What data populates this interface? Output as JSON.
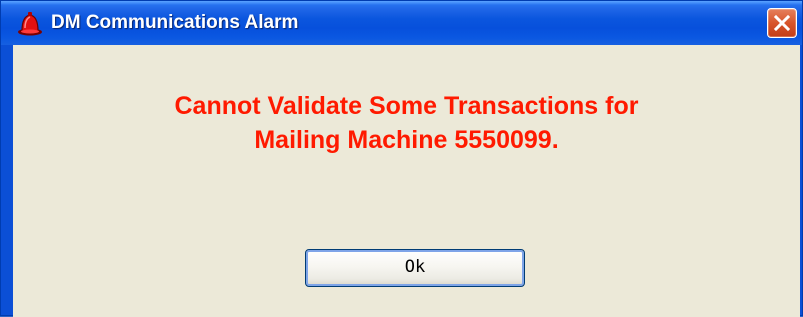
{
  "window": {
    "title": "DM Communications Alarm",
    "icon": "alarm-bell-icon",
    "close_icon": "close-icon"
  },
  "message": {
    "line1": "Cannot Validate Some Transactions for",
    "line2": "Mailing Machine 5550099.",
    "color": "#ff1a00"
  },
  "buttons": {
    "ok_label": "Ok"
  }
}
